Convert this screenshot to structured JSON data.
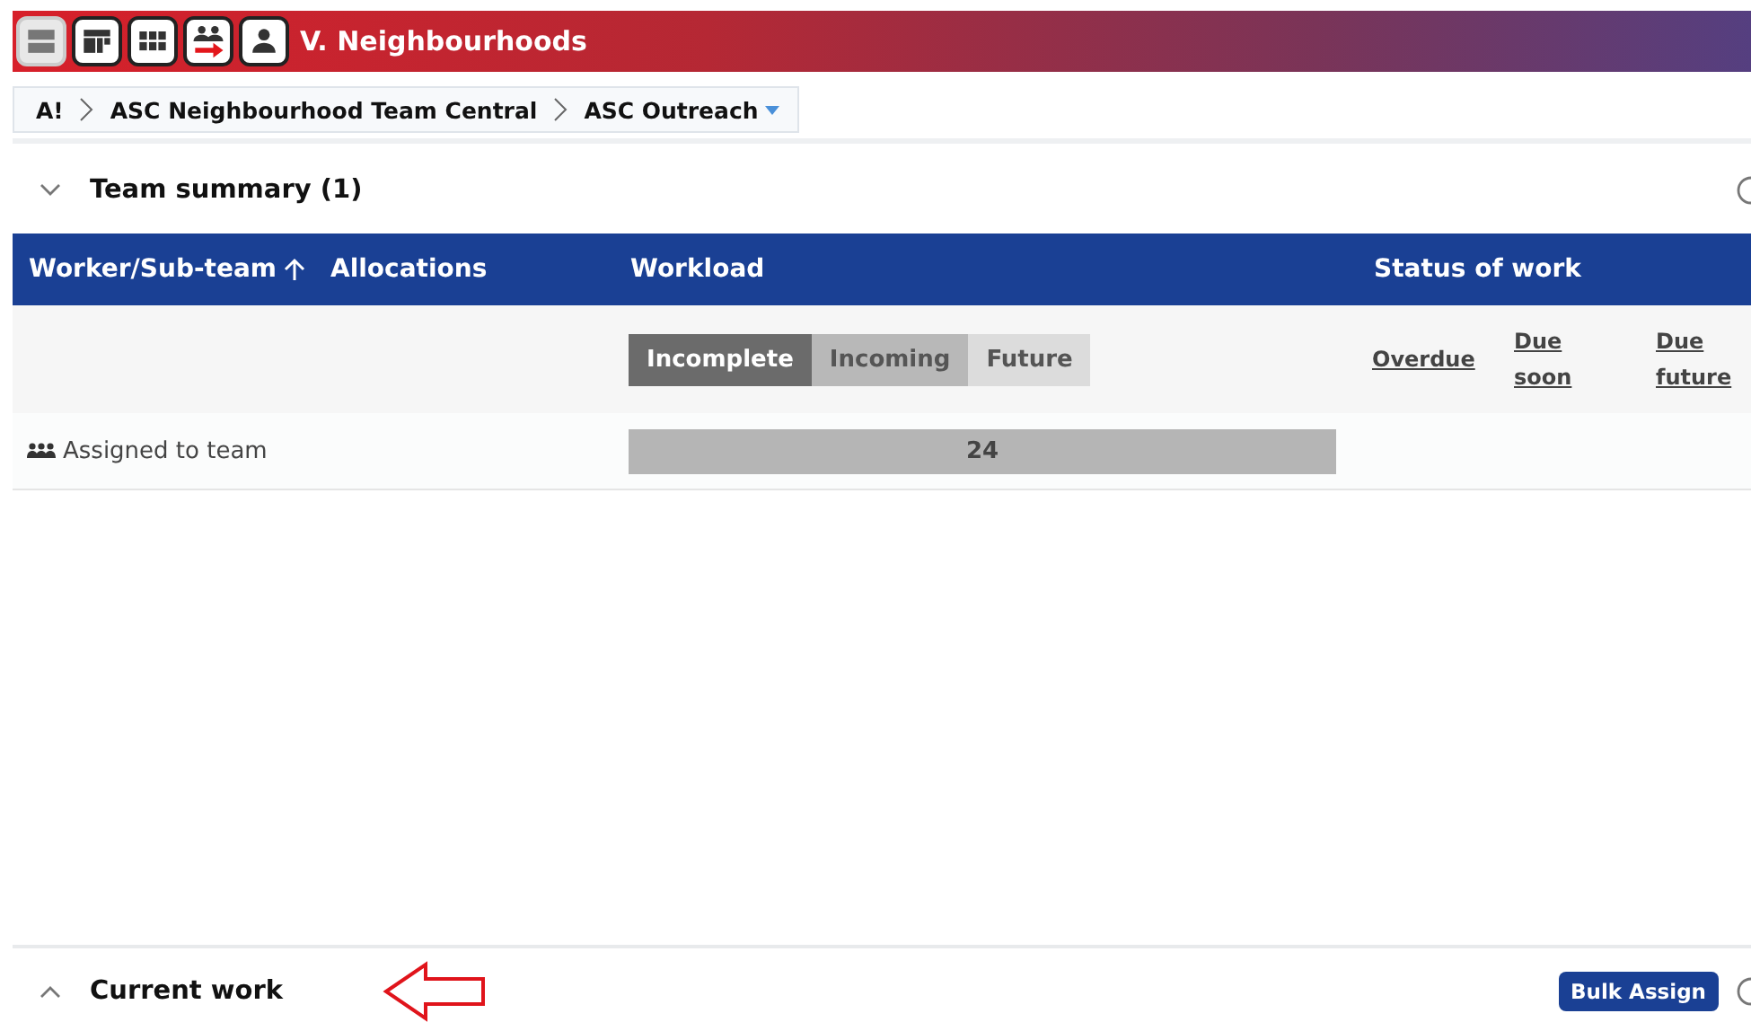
{
  "header": {
    "title": "V. Neighbourhoods",
    "icons": [
      {
        "kind": "rows",
        "selected": true
      },
      {
        "kind": "dashboard",
        "selected": false
      },
      {
        "kind": "grid",
        "selected": false
      },
      {
        "kind": "team-transfer",
        "selected": false
      },
      {
        "kind": "person",
        "selected": false
      }
    ]
  },
  "breadcrumb": [
    {
      "label": "A!",
      "dropdown": false
    },
    {
      "label": "ASC Neighbourhood Team Central",
      "dropdown": false
    },
    {
      "label": "ASC Outreach",
      "dropdown": true
    }
  ],
  "team_summary": {
    "title": "Team summary (1)",
    "expanded": true,
    "columns": [
      {
        "label": "Worker/Sub-team",
        "sorted": true
      },
      {
        "label": "Allocations",
        "sorted": false
      },
      {
        "label": "Workload",
        "sorted": false
      },
      {
        "label": "Status of work",
        "sorted": false
      }
    ],
    "workload_tabs": [
      {
        "label": "Incomplete",
        "selected": true,
        "color": "#6b6b6b"
      },
      {
        "label": "Incoming",
        "selected": false,
        "color": "#b8b8b8"
      },
      {
        "label": "Future",
        "selected": false,
        "color": "#dcdcdc"
      }
    ],
    "status_links": [
      "Overdue",
      "Due soon",
      "Due future"
    ],
    "rows": [
      {
        "worker": "Assigned to team",
        "workload": "24"
      }
    ]
  },
  "current_work": {
    "title": "Current work",
    "expanded": false,
    "button": "Bulk Assign"
  }
}
